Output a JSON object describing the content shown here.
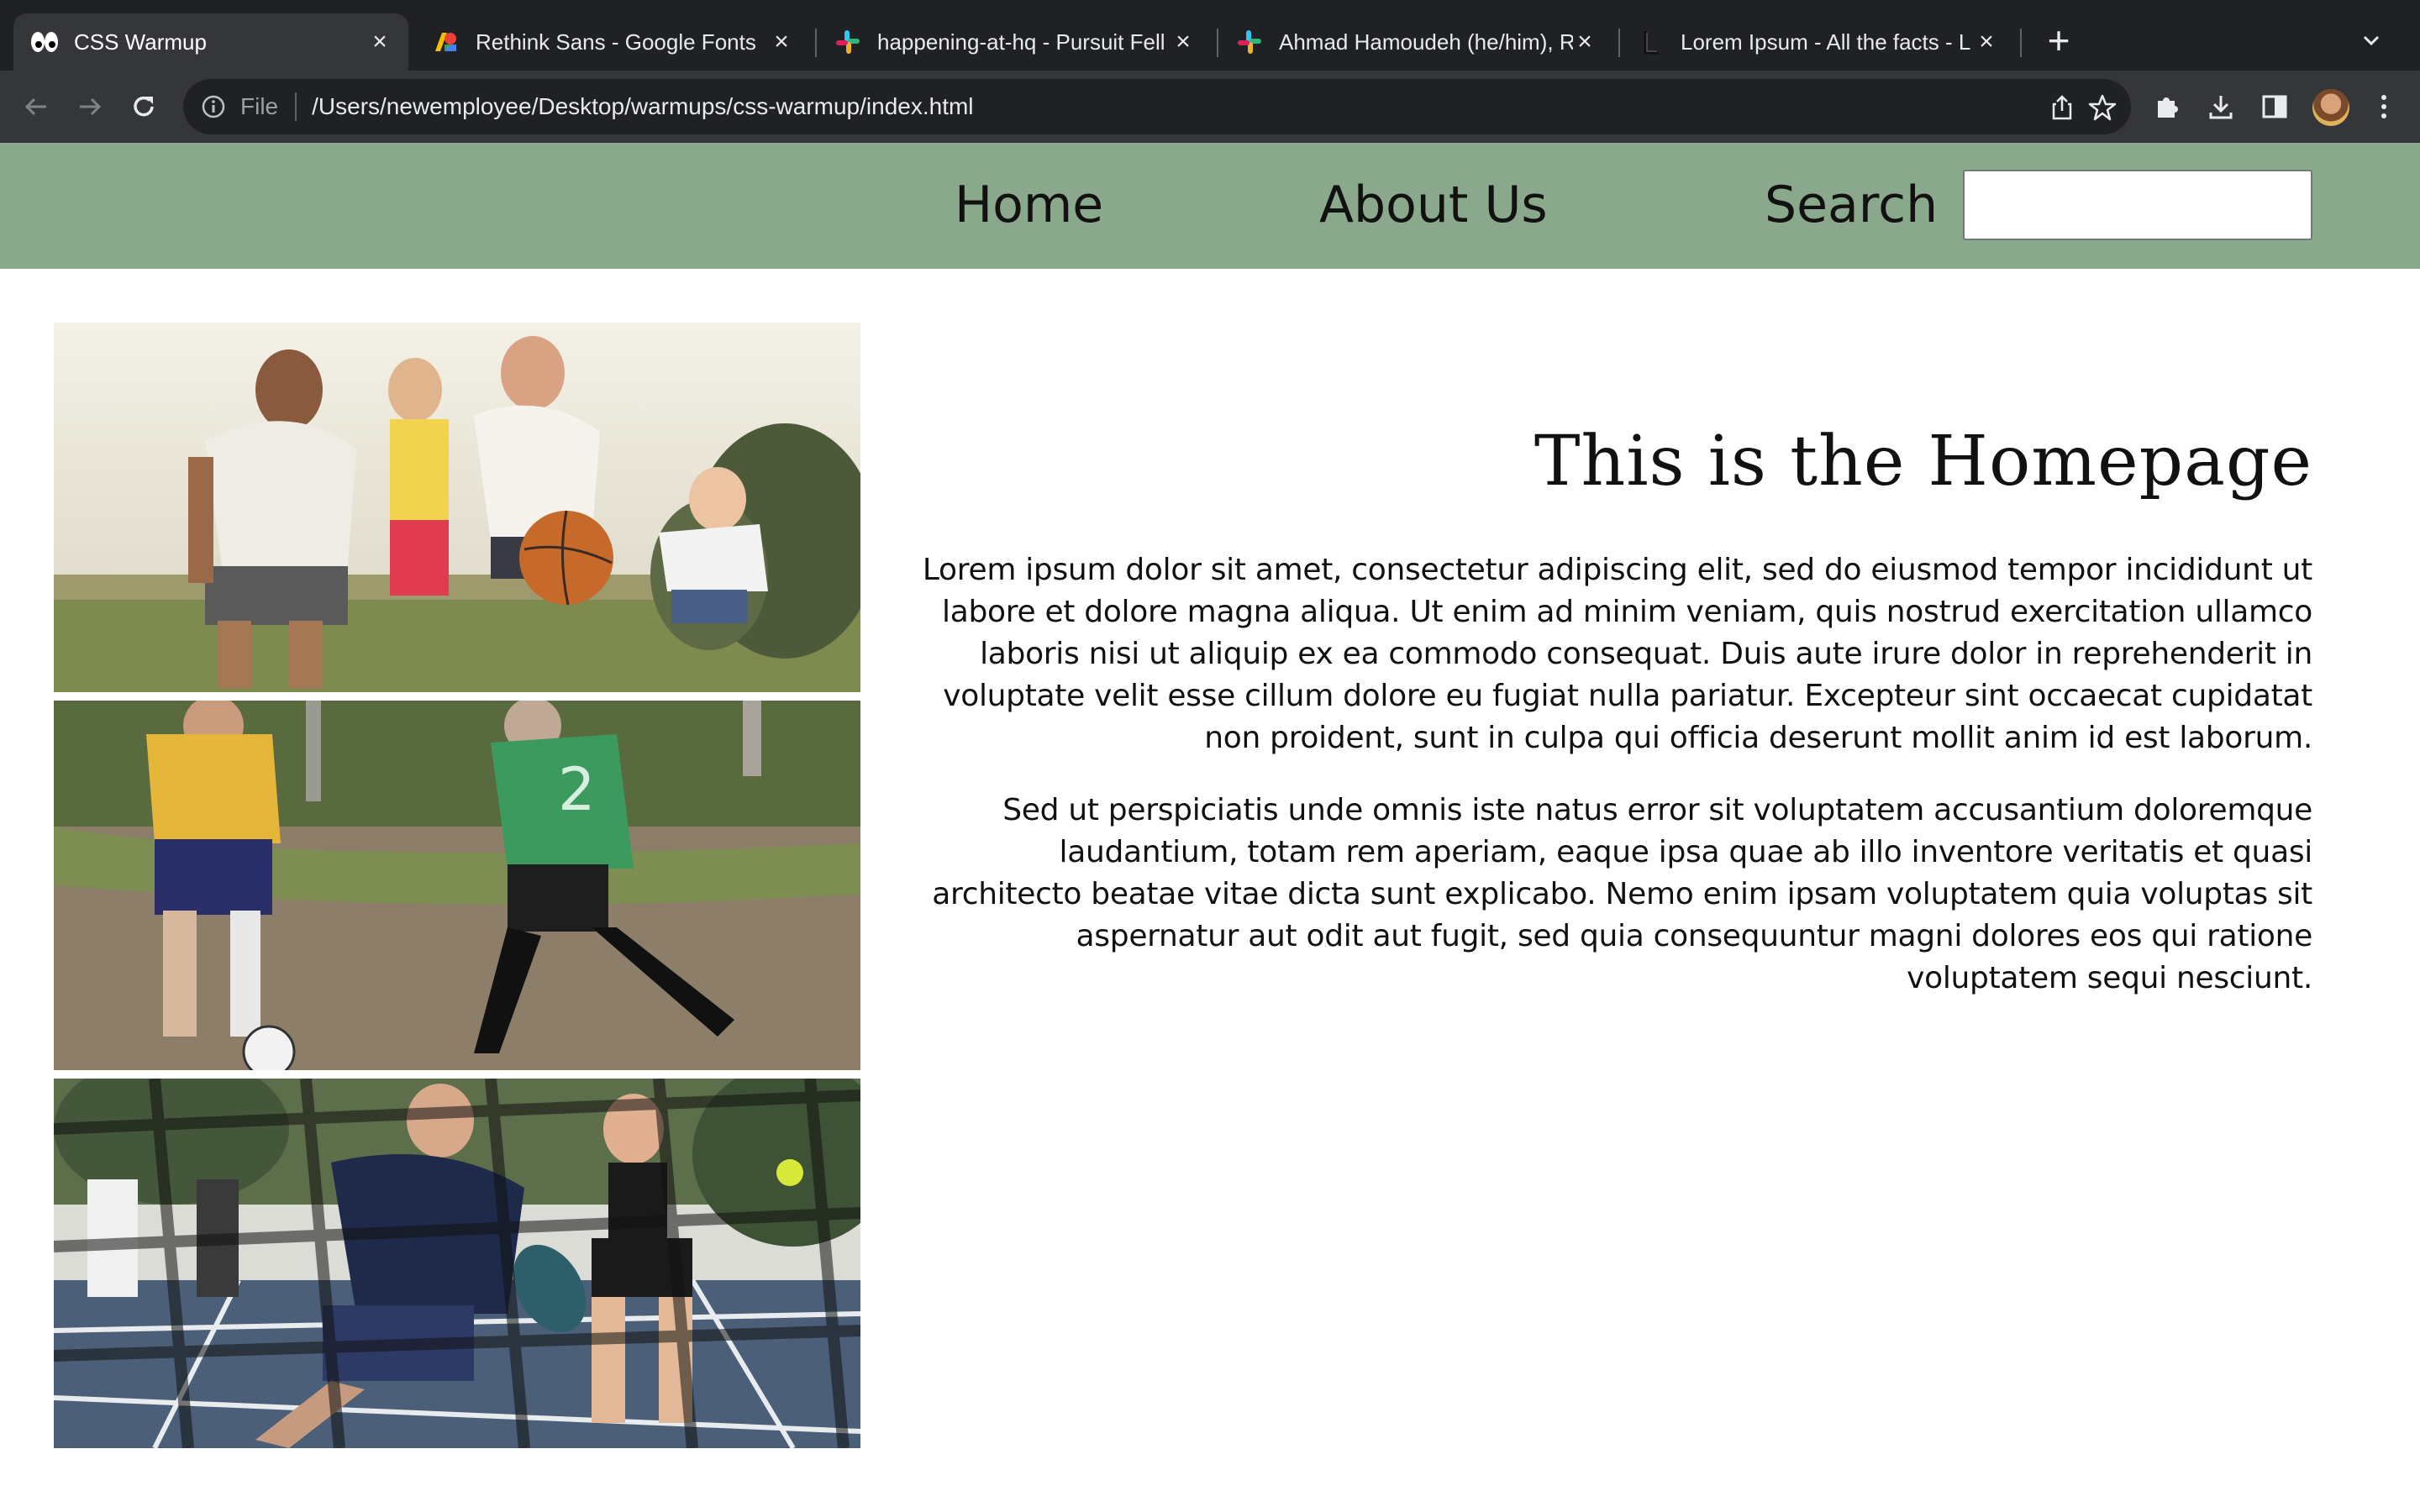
{
  "browser": {
    "tabs": [
      {
        "title": "CSS Warmup",
        "icon": "eyes-icon",
        "active": true
      },
      {
        "title": "Rethink Sans - Google Fonts",
        "icon": "google-fonts-icon",
        "active": false
      },
      {
        "title": "happening-at-hq - Pursuit Fell",
        "icon": "slack-icon",
        "active": false
      },
      {
        "title": "Ahmad Hamoudeh (he/him), R",
        "icon": "slack-icon",
        "active": false
      },
      {
        "title": "Lorem Ipsum - All the facts - L",
        "icon": "lorem-ipsum-icon",
        "active": false
      }
    ],
    "address": {
      "scheme_label": "File",
      "url": "/Users/newemployee/Desktop/warmups/css-warmup/index.html"
    },
    "colors": {
      "frame": "#202124",
      "toolbar": "#35363a",
      "text": "#e8eaed"
    }
  },
  "site": {
    "nav": {
      "home_label": "Home",
      "about_label": "About Us",
      "search_label": "Search",
      "search_value": "",
      "background": "#8aa88b"
    },
    "photos": [
      {
        "subject": "family playing basketball"
      },
      {
        "subject": "older men playing soccer"
      },
      {
        "subject": "pickleball doubles match"
      }
    ],
    "main": {
      "heading": "This is the Homepage",
      "paragraphs": [
        "Lorem ipsum dolor sit amet, consectetur adipiscing elit, sed do eiusmod tempor incididunt ut labore et dolore magna aliqua. Ut enim ad minim veniam, quis nostrud exercitation ullamco laboris nisi ut aliquip ex ea commodo consequat. Duis aute irure dolor in reprehenderit in voluptate velit esse cillum dolore eu fugiat nulla pariatur. Excepteur sint occaecat cupidatat non proident, sunt in culpa qui officia deserunt mollit anim id est laborum.",
        "Sed ut perspiciatis unde omnis iste natus error sit voluptatem accusantium doloremque laudantium, totam rem aperiam, eaque ipsa quae ab illo inventore veritatis et quasi architecto beatae vitae dicta sunt explicabo. Nemo enim ipsam voluptatem quia voluptas sit aspernatur aut odit aut fugit, sed quia consequuntur magni dolores eos qui ratione voluptatem sequi nesciunt."
      ]
    }
  }
}
